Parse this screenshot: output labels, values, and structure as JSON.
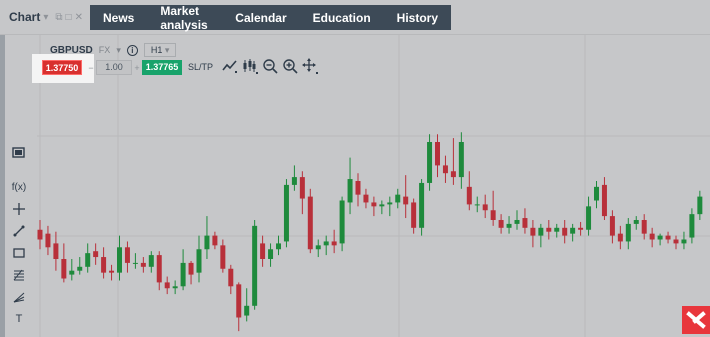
{
  "header": {
    "chart_label": "Chart",
    "nav": [
      "News",
      "Market analysis",
      "Calendar",
      "Education",
      "History"
    ]
  },
  "symbol": {
    "name": "GBPUSD",
    "type": "FX",
    "info_icon": "info-icon",
    "timeframe": "H1"
  },
  "ticket": {
    "sell_price": "1.37750",
    "minus": "−",
    "quantity": "1.00",
    "plus": "+",
    "buy_price": "1.37765",
    "sltp": "SL/TP"
  },
  "toolbar_icons": [
    "chart-type-icon",
    "indicators-icon",
    "zoom-out-icon",
    "zoom-in-icon",
    "move-icon"
  ],
  "left_tools": [
    "screen-icon",
    "formula-icon",
    "crosshair-icon",
    "trendline-icon",
    "rectangle-icon",
    "fibonacci-icon",
    "fan-icon",
    "text-icon"
  ],
  "left_tool_labels": {
    "formula": "f(x)",
    "text": "T"
  },
  "colors": {
    "bull": "#1e8a3c",
    "bear": "#b8303a",
    "nav_bg": "#3d4a57",
    "sell": "#d8302e",
    "buy": "#18a36b",
    "brand": "#e8363c"
  },
  "chart_data": {
    "type": "candlestick",
    "candles": [
      {
        "o": 55,
        "c": 50,
        "h": 45,
        "l": 60
      },
      {
        "o": 53,
        "c": 46,
        "h": 42,
        "l": 57
      },
      {
        "o": 48,
        "c": 40,
        "h": 34,
        "l": 54
      },
      {
        "o": 40,
        "c": 30,
        "h": 28,
        "l": 48
      },
      {
        "o": 32,
        "c": 34,
        "h": 29,
        "l": 40
      },
      {
        "o": 34,
        "c": 36,
        "h": 32,
        "l": 41
      },
      {
        "o": 36,
        "c": 43,
        "h": 33,
        "l": 48
      },
      {
        "o": 44,
        "c": 41,
        "h": 37,
        "l": 48
      },
      {
        "o": 41,
        "c": 33,
        "h": 30,
        "l": 46
      },
      {
        "o": 34,
        "c": 33,
        "h": 29,
        "l": 37
      },
      {
        "o": 33,
        "c": 46,
        "h": 29,
        "l": 52
      },
      {
        "o": 46,
        "c": 38,
        "h": 33,
        "l": 49
      },
      {
        "o": 38,
        "c": 38,
        "h": 35,
        "l": 43
      },
      {
        "o": 38,
        "c": 36,
        "h": 33,
        "l": 41
      },
      {
        "o": 36,
        "c": 42,
        "h": 33,
        "l": 44
      },
      {
        "o": 42,
        "c": 28,
        "h": 24,
        "l": 44
      },
      {
        "o": 28,
        "c": 25,
        "h": 22,
        "l": 31
      },
      {
        "o": 25,
        "c": 26,
        "h": 22,
        "l": 29
      },
      {
        "o": 26,
        "c": 38,
        "h": 24,
        "l": 45
      },
      {
        "o": 38,
        "c": 32,
        "h": 27,
        "l": 39
      },
      {
        "o": 33,
        "c": 45,
        "h": 28,
        "l": 52
      },
      {
        "o": 45,
        "c": 52,
        "h": 40,
        "l": 62
      },
      {
        "o": 52,
        "c": 47,
        "h": 45,
        "l": 54
      },
      {
        "o": 47,
        "c": 35,
        "h": 33,
        "l": 50
      },
      {
        "o": 35,
        "c": 26,
        "h": 22,
        "l": 37
      },
      {
        "o": 27,
        "c": 10,
        "h": 3,
        "l": 28
      },
      {
        "o": 11,
        "c": 16,
        "h": 8,
        "l": 25
      },
      {
        "o": 16,
        "c": 57,
        "h": 14,
        "l": 60
      },
      {
        "o": 48,
        "c": 40,
        "h": 36,
        "l": 52
      },
      {
        "o": 40,
        "c": 45,
        "h": 36,
        "l": 48
      },
      {
        "o": 45,
        "c": 48,
        "h": 42,
        "l": 52
      },
      {
        "o": 49,
        "c": 78,
        "h": 46,
        "l": 81
      },
      {
        "o": 78,
        "c": 82,
        "h": 75,
        "l": 88
      },
      {
        "o": 82,
        "c": 71,
        "h": 63,
        "l": 85
      },
      {
        "o": 72,
        "c": 45,
        "h": 43,
        "l": 76
      },
      {
        "o": 45,
        "c": 47,
        "h": 41,
        "l": 50
      },
      {
        "o": 47,
        "c": 49,
        "h": 42,
        "l": 52
      },
      {
        "o": 49,
        "c": 47,
        "h": 43,
        "l": 55
      },
      {
        "o": 48,
        "c": 70,
        "h": 44,
        "l": 72
      },
      {
        "o": 69,
        "c": 81,
        "h": 63,
        "l": 92
      },
      {
        "o": 80,
        "c": 73,
        "h": 67,
        "l": 84
      },
      {
        "o": 73,
        "c": 69,
        "h": 66,
        "l": 76
      },
      {
        "o": 69,
        "c": 67,
        "h": 62,
        "l": 72
      },
      {
        "o": 67,
        "c": 68,
        "h": 63,
        "l": 70
      },
      {
        "o": 68,
        "c": 69,
        "h": 62,
        "l": 72
      },
      {
        "o": 69,
        "c": 73,
        "h": 66,
        "l": 76
      },
      {
        "o": 72,
        "c": 68,
        "h": 61,
        "l": 83
      },
      {
        "o": 69,
        "c": 56,
        "h": 53,
        "l": 71
      },
      {
        "o": 56,
        "c": 79,
        "h": 52,
        "l": 81
      },
      {
        "o": 79,
        "c": 100,
        "h": 75,
        "l": 104
      },
      {
        "o": 100,
        "c": 88,
        "h": 82,
        "l": 104
      },
      {
        "o": 88,
        "c": 84,
        "h": 79,
        "l": 93
      },
      {
        "o": 85,
        "c": 82,
        "h": 78,
        "l": 102
      },
      {
        "o": 82,
        "c": 100,
        "h": 76,
        "l": 105
      },
      {
        "o": 77,
        "c": 68,
        "h": 65,
        "l": 85
      },
      {
        "o": 68,
        "c": 68,
        "h": 64,
        "l": 72
      },
      {
        "o": 68,
        "c": 65,
        "h": 61,
        "l": 73
      },
      {
        "o": 65,
        "c": 60,
        "h": 57,
        "l": 75
      },
      {
        "o": 60,
        "c": 56,
        "h": 53,
        "l": 63
      },
      {
        "o": 56,
        "c": 58,
        "h": 53,
        "l": 62
      },
      {
        "o": 58,
        "c": 60,
        "h": 55,
        "l": 65
      },
      {
        "o": 61,
        "c": 56,
        "h": 53,
        "l": 66
      },
      {
        "o": 56,
        "c": 52,
        "h": 46,
        "l": 60
      },
      {
        "o": 52,
        "c": 56,
        "h": 46,
        "l": 58
      },
      {
        "o": 56,
        "c": 54,
        "h": 50,
        "l": 60
      },
      {
        "o": 54,
        "c": 56,
        "h": 51,
        "l": 58
      },
      {
        "o": 56,
        "c": 52,
        "h": 48,
        "l": 60
      },
      {
        "o": 53,
        "c": 56,
        "h": 49,
        "l": 58
      },
      {
        "o": 56,
        "c": 55,
        "h": 52,
        "l": 59
      },
      {
        "o": 55,
        "c": 67,
        "h": 52,
        "l": 72
      },
      {
        "o": 70,
        "c": 77,
        "h": 66,
        "l": 80
      },
      {
        "o": 78,
        "c": 62,
        "h": 60,
        "l": 82
      },
      {
        "o": 62,
        "c": 52,
        "h": 48,
        "l": 65
      },
      {
        "o": 53,
        "c": 49,
        "h": 45,
        "l": 57
      },
      {
        "o": 49,
        "c": 58,
        "h": 45,
        "l": 61
      },
      {
        "o": 58,
        "c": 60,
        "h": 55,
        "l": 62
      },
      {
        "o": 60,
        "c": 53,
        "h": 50,
        "l": 63
      },
      {
        "o": 53,
        "c": 50,
        "h": 46,
        "l": 56
      },
      {
        "o": 50,
        "c": 52,
        "h": 47,
        "l": 53
      },
      {
        "o": 52,
        "c": 50,
        "h": 48,
        "l": 54
      },
      {
        "o": 50,
        "c": 48,
        "h": 45,
        "l": 52
      },
      {
        "o": 48,
        "c": 50,
        "h": 45,
        "l": 54
      },
      {
        "o": 51,
        "c": 63,
        "h": 48,
        "l": 66
      },
      {
        "o": 63,
        "c": 72,
        "h": 60,
        "l": 75
      }
    ]
  }
}
